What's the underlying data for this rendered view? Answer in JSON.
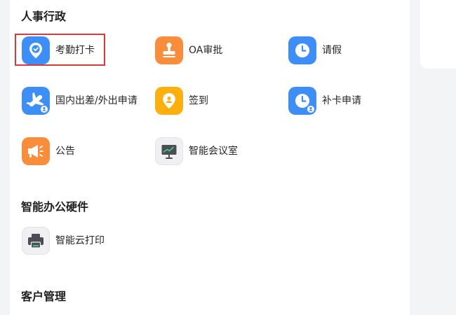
{
  "sections": [
    {
      "title": "人事行政",
      "apps": [
        {
          "label": "考勤打卡",
          "icon": "location-check-icon",
          "color": "#3d8ef7"
        },
        {
          "label": "OA审批",
          "icon": "stamp-icon",
          "color": "#fa8d3c"
        },
        {
          "label": "请假",
          "icon": "clock-icon",
          "color": "#3d8ef7"
        },
        {
          "label": "国内出差/外出申请",
          "icon": "plane-icon",
          "color": "#3d8ef7"
        },
        {
          "label": "签到",
          "icon": "location-pin-icon",
          "color": "#fcb00f"
        },
        {
          "label": "补卡申请",
          "icon": "clock-icon",
          "color": "#3d8ef7"
        },
        {
          "label": "公告",
          "icon": "megaphone-icon",
          "color": "#fa8d3c"
        },
        {
          "label": "智能会议室",
          "icon": "presentation-board-icon",
          "color": "#f0f0f2"
        }
      ]
    },
    {
      "title": "智能办公硬件",
      "apps": [
        {
          "label": "智能云打印",
          "icon": "printer-icon",
          "color": "#f0f0f2"
        }
      ]
    },
    {
      "title": "客户管理",
      "apps": []
    }
  ],
  "colors": {
    "highlight": "#d63a3a",
    "accent_blue": "#3d8ef7",
    "accent_orange": "#fa8d3c",
    "accent_yellow": "#fcb00f"
  }
}
